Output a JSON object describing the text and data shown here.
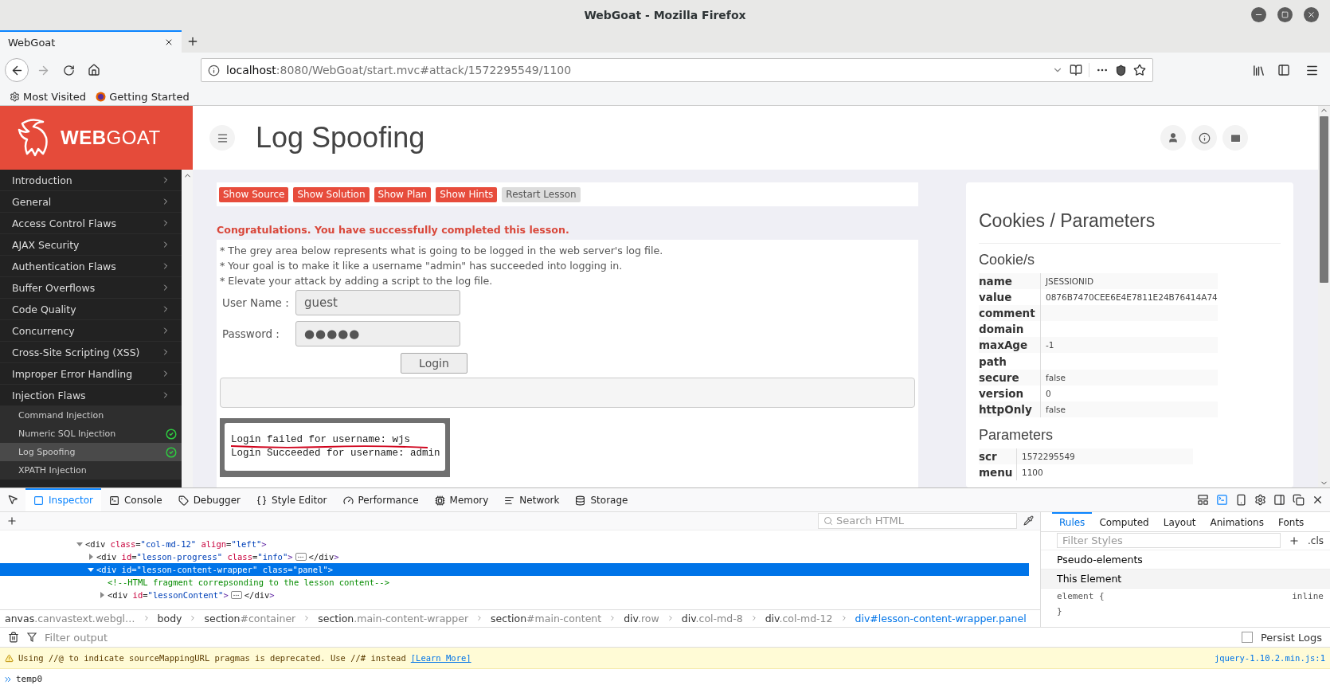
{
  "window": {
    "title": "WebGoat - Mozilla Firefox"
  },
  "browser_tabs": [
    {
      "label": "WebGoat",
      "selected": true
    }
  ],
  "address_bar": {
    "url": "localhost:8080/WebGoat/start.mvc#attack/1572295549/1100"
  },
  "bookmarks": [
    {
      "label": "Most Visited"
    },
    {
      "label": "Getting Started"
    }
  ],
  "webgoat": {
    "logo": "**WEB**GOAT",
    "lesson_title": "Log Spoofing",
    "sidebar": [
      {
        "label": "Introduction"
      },
      {
        "label": "General"
      },
      {
        "label": "Access Control Flaws"
      },
      {
        "label": "AJAX Security"
      },
      {
        "label": "Authentication Flaws"
      },
      {
        "label": "Buffer Overflows"
      },
      {
        "label": "Code Quality"
      },
      {
        "label": "Concurrency"
      },
      {
        "label": "Cross-Site Scripting (XSS)"
      },
      {
        "label": "Improper Error Handling"
      },
      {
        "label": "Injection Flaws",
        "children": [
          {
            "label": "Command Injection",
            "completed": false,
            "selected": false
          },
          {
            "label": "Numeric SQL Injection",
            "completed": true,
            "selected": false
          },
          {
            "label": "Log Spoofing",
            "completed": true,
            "selected": true
          },
          {
            "label": "XPATH Injection",
            "completed": false,
            "selected": false
          }
        ]
      }
    ],
    "lesson_buttons": [
      {
        "label": "Show Source",
        "kind": "primary"
      },
      {
        "label": "Show Solution",
        "kind": "primary"
      },
      {
        "label": "Show Plan",
        "kind": "primary"
      },
      {
        "label": "Show Hints",
        "kind": "primary"
      },
      {
        "label": "Restart Lesson",
        "kind": "secondary"
      }
    ],
    "success_message": "Congratulations. You have successfully completed this lesson.",
    "instructions": [
      "* The grey area below represents what is going to be logged in the web server's log file.",
      "* Your goal is to make it like a username \"admin\" has succeeded into logging in.",
      "* Elevate your attack by adding a script to the log file."
    ],
    "form": {
      "username_label": "User Name :",
      "username": "guest",
      "password_label": "Password :",
      "password": "●●●●●",
      "login_button": "Login"
    },
    "log_output": [
      {
        "text": "Login failed for username: wjs",
        "underlined": true
      },
      {
        "text": "Login Succeeded for username: admin",
        "underlined": false
      }
    ],
    "cookies_panel": {
      "title": "Cookies / Parameters",
      "cookies_heading": "Cookie/s",
      "cookies": [
        {
          "key": "name",
          "value": "JSESSIONID"
        },
        {
          "key": "value",
          "value": "0876B7470CEE6E4E7811E24B76414A74"
        },
        {
          "key": "comment"
        },
        {
          "key": "domain"
        },
        {
          "key": "maxAge",
          "value": "-1"
        },
        {
          "key": "path"
        },
        {
          "key": "secure",
          "value": "false"
        },
        {
          "key": "version",
          "value": "0"
        },
        {
          "key": "httpOnly",
          "value": "false"
        }
      ],
      "parameters_heading": "Parameters",
      "parameters": [
        {
          "key": "scr",
          "value": "1572295549"
        },
        {
          "key": "menu",
          "value": "1100"
        }
      ]
    }
  },
  "devtools": {
    "tabs": [
      {
        "label": "Inspector",
        "selected": true
      },
      {
        "label": "Console",
        "selected": false
      },
      {
        "label": "Debugger",
        "selected": false
      },
      {
        "label": "Style Editor",
        "selected": false
      },
      {
        "label": "Performance",
        "selected": false
      },
      {
        "label": "Memory",
        "selected": false
      },
      {
        "label": "Network",
        "selected": false
      },
      {
        "label": "Storage",
        "selected": false
      }
    ],
    "search_placeholder": "Search HTML",
    "markup": [
      {
        "kind": "element",
        "open": "<div class=\"col-md-12\" align=\"left\">",
        "expanded": true,
        "selected": false,
        "children": [
          {
            "kind": "element",
            "open": "<div id=\"lesson-progress\" class=\"info\">",
            "close": "</div>",
            "expanded": false,
            "selected": false
          },
          {
            "kind": "element",
            "open": "<div id=\"lesson-content-wrapper\" class=\"panel\">",
            "expanded": true,
            "selected": true,
            "children": [
              {
                "kind": "comment",
                "text": "<!--HTML fragment correpsonding to the lesson content-->"
              },
              {
                "kind": "element",
                "open": "<div id=\"lessonContent\">",
                "close": "</div>",
                "expanded": false,
                "selected": false
              }
            ]
          }
        ]
      }
    ],
    "breadcrumbs": [
      {
        "label": "anvas.canvastext.webgl…",
        "selected": false
      },
      {
        "label": "body",
        "selected": false
      },
      {
        "label": "section#container",
        "selected": false
      },
      {
        "label": "section.main-content-wrapper",
        "selected": false
      },
      {
        "label": "section#main-content",
        "selected": false
      },
      {
        "label": "div.row",
        "selected": false
      },
      {
        "label": "div.col-md-8",
        "selected": false
      },
      {
        "label": "div.col-md-12",
        "selected": false
      },
      {
        "label": "div#lesson-content-wrapper.panel",
        "selected": true
      }
    ],
    "rules_tabs": [
      {
        "label": "Rules",
        "selected": true
      },
      {
        "label": "Computed",
        "selected": false
      },
      {
        "label": "Layout",
        "selected": false
      },
      {
        "label": "Animations",
        "selected": false
      },
      {
        "label": "Fonts",
        "selected": false
      }
    ],
    "filter_styles_placeholder": "Filter Styles",
    "cls_label": ".cls",
    "rules": {
      "pseudo_elements": "Pseudo-elements",
      "this_element": "This Element",
      "selector": "element {",
      "source": "inline",
      "close": "}"
    },
    "console": {
      "filter_placeholder": "Filter output",
      "persist_logs": {
        "label": "Persist Logs",
        "checked": false
      },
      "messages": [
        {
          "text": "Using //@ to indicate sourceMappingURL pragmas is deprecated. Use //# instead",
          "link": "[Learn More]",
          "source": "jquery-1.10.2.min.js:1"
        }
      ],
      "input": "temp0"
    }
  }
}
